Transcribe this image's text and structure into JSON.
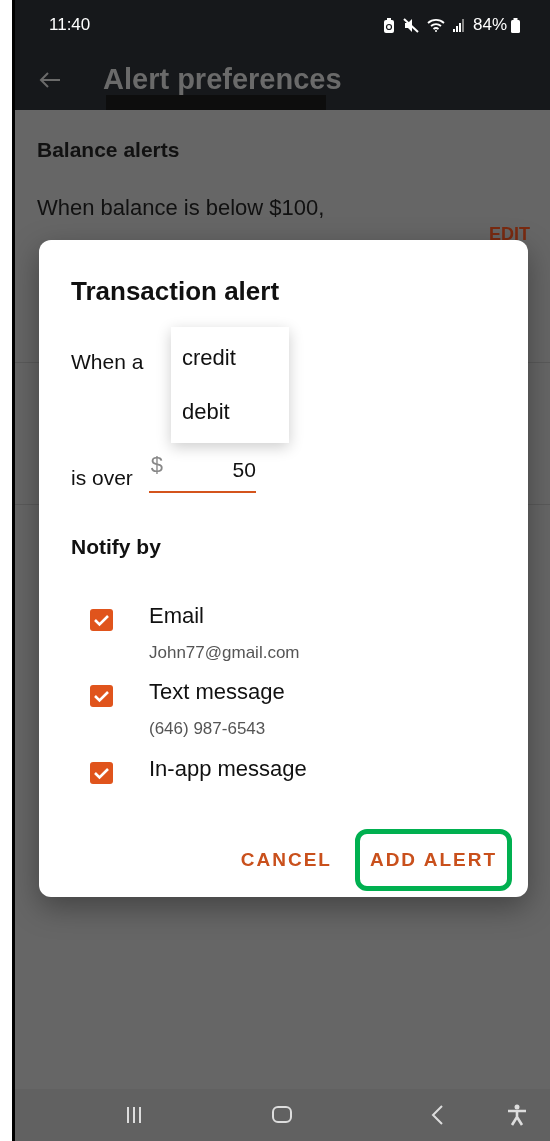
{
  "status_bar": {
    "time": "11:40",
    "battery": "84%"
  },
  "app_bar": {
    "title": "Alert preferences"
  },
  "balance_alerts": {
    "heading": "Balance alerts",
    "description_lines": [
      "When balance is below $100,"
    ],
    "edit": "EDIT"
  },
  "dialog": {
    "title": "Transaction alert",
    "when_label": "When a",
    "dropdown_options": [
      {
        "label": "credit"
      },
      {
        "label": "debit"
      }
    ],
    "amount_label": "is over",
    "amount": {
      "prefix": "$",
      "value": "50"
    },
    "notify_heading": "Notify by",
    "channels": [
      {
        "label": "Email",
        "detail": "John77@gmail.com",
        "checked": true
      },
      {
        "label": "Text message",
        "detail": "(646) 987-6543",
        "checked": true
      },
      {
        "label": "In-app message",
        "checked": true
      }
    ],
    "buttons": [
      {
        "label": "CANCEL",
        "highlighted": false
      },
      {
        "label": "ADD ALERT",
        "highlighted": true
      }
    ]
  }
}
